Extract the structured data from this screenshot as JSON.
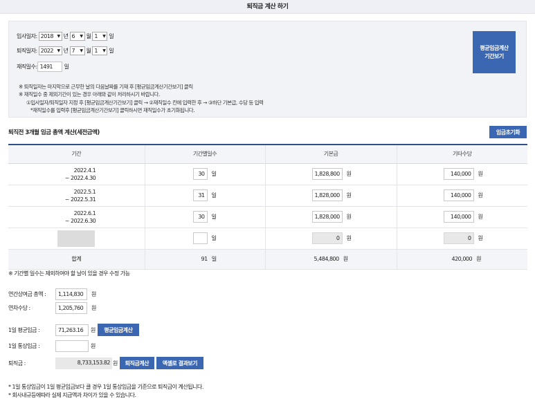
{
  "page": {
    "title": "퇴직금 계산 하기"
  },
  "dates": {
    "join_label": "입사일자:",
    "join_year": "2018",
    "join_month": "6",
    "join_day": "1",
    "leave_label": "퇴직일자:",
    "leave_year": "2022",
    "leave_month": "7",
    "leave_day": "1",
    "unit_year": "년",
    "unit_month": "월",
    "unit_day": "일",
    "tenure_label": "재직일수:",
    "tenure_value": "1491",
    "tenure_unit": "일",
    "avg_period_button": "평균임금계산\n기간보기"
  },
  "notes": [
    "※ 퇴직일자는 마지막으로 근무한 날의 다음날짜를 기재 후 [평균임금계산기간보기] 클릭",
    "※ 재직일수 중 제외기간이 있는 경우 아래와 같이 처리하시기 바랍니다.",
    "①입사일자/퇴직일자 지정 후 [평균임금계산기간보기] 클릭 → ②재직일수 칸에 입력한 후 → ③하단 기본급, 수당 등 입력",
    "*재직일수를 입력후 [평균임금계산기간보기] 클릭하시면 재직일수가 초기화됩니다."
  ],
  "wage": {
    "title": "퇴직전 3개월 임금 총액 계산(세전금액)",
    "reset_button": "임금초기화",
    "headers": [
      "기간",
      "기간별일수",
      "기본급",
      "기타수당"
    ],
    "rows": [
      {
        "from": "2022.4.1",
        "to": "~ 2022.4.30",
        "days": "30",
        "base": "1,828,800",
        "extra": "140,000"
      },
      {
        "from": "2022.5.1",
        "to": "~ 2022.5.31",
        "days": "31",
        "base": "1,828,000",
        "extra": "140,000"
      },
      {
        "from": "2022.6.1",
        "to": "~ 2022.6.30",
        "days": "30",
        "base": "1,828,000",
        "extra": "140,000"
      },
      {
        "from": "",
        "to": "",
        "days": "",
        "base": "0",
        "extra": "0"
      }
    ],
    "unit_day": "일",
    "unit_won": "원",
    "sum_label": "합계",
    "sum_days": "91",
    "sum_base": "5,484,800",
    "sum_extra": "420,000"
  },
  "note2": "※ 기간별 일수는 제외하여야 할 날이 있을 경우 수정 가능",
  "bonus": {
    "annual_bonus_label": "연간상여금 총액 :",
    "annual_bonus_value": "1,114,830",
    "annual_leave_label": "연차수당 :",
    "annual_leave_value": "1,205,760",
    "unit_won": "원"
  },
  "result": {
    "avg_wage_label": "1일 평균임금 :",
    "avg_wage_value": "71,263.16",
    "avg_wage_button": "평균임금계산",
    "normal_wage_label": "1일 통상임금 :",
    "normal_wage_value": "",
    "severance_label": "퇴직금 :",
    "severance_value": "8,733,153.82",
    "severance_button": "퇴직금계산",
    "excel_button": "엑셀로 결과보기",
    "unit_won": "원"
  },
  "footnotes": [
    "* 1일 통상임금이 1일 평균임금보다 클 경우 1일 통상임금을 기준으로 퇴직금이 계산됩니다.",
    "* 회사내규등에따라 실제 지급액과 차이가 있을 수 있습니다."
  ]
}
